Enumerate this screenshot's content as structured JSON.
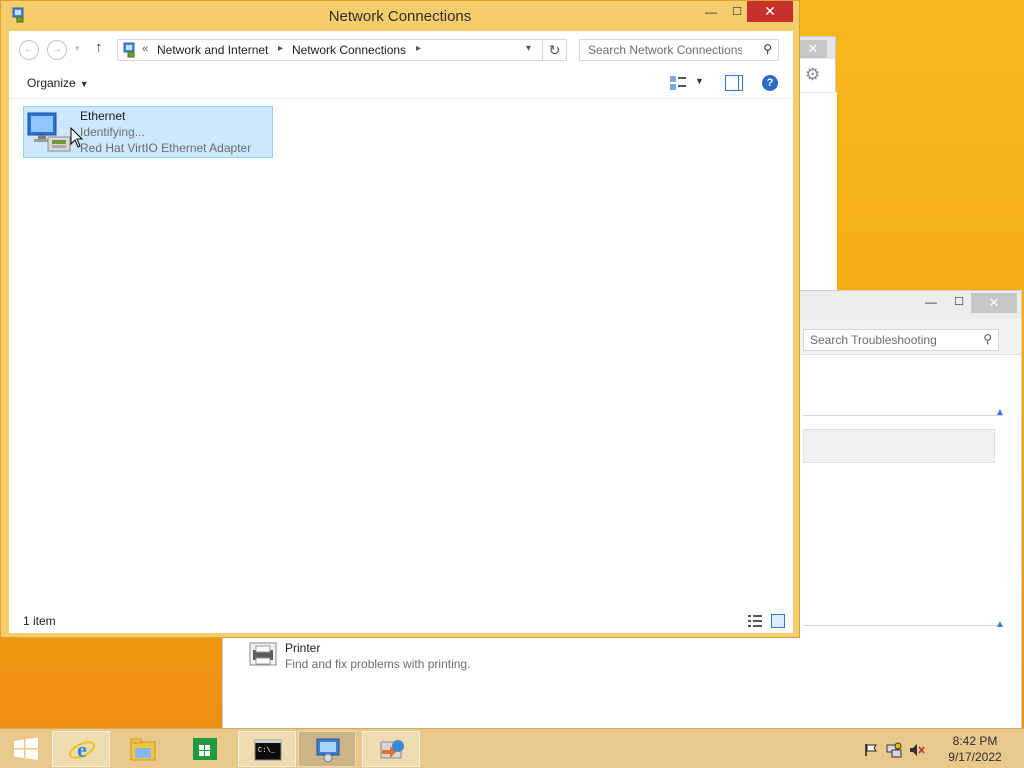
{
  "window": {
    "title": "Network Connections"
  },
  "navigation": {
    "breadcrumb_prefix": "«",
    "breadcrumbs": [
      "Network and Internet",
      "Network Connections"
    ],
    "search_placeholder": "Search Network Connections"
  },
  "command_bar": {
    "organize_label": "Organize"
  },
  "items": [
    {
      "name": "Ethernet",
      "status": "Identifying...",
      "device": "Red Hat VirtIO Ethernet Adapter"
    }
  ],
  "status_bar": {
    "item_count": "1 item"
  },
  "background_windows": {
    "troubleshooting": {
      "search_placeholder": "Search Troubleshooting",
      "printer_title": "Printer",
      "printer_desc": "Find and fix problems with printing."
    }
  },
  "taskbar": {
    "apps": [
      "start-icon",
      "internet-explorer-icon",
      "file-explorer-icon",
      "store-icon",
      "command-prompt-icon",
      "control-panel-icon",
      "remote-desktop-icon"
    ],
    "clock_time": "8:42 PM",
    "clock_date": "9/17/2022"
  },
  "colors": {
    "accent": "#f5cd6b",
    "selection": "#cce8ff",
    "close_button": "#c7302b",
    "desktop": "#f3b21a"
  }
}
